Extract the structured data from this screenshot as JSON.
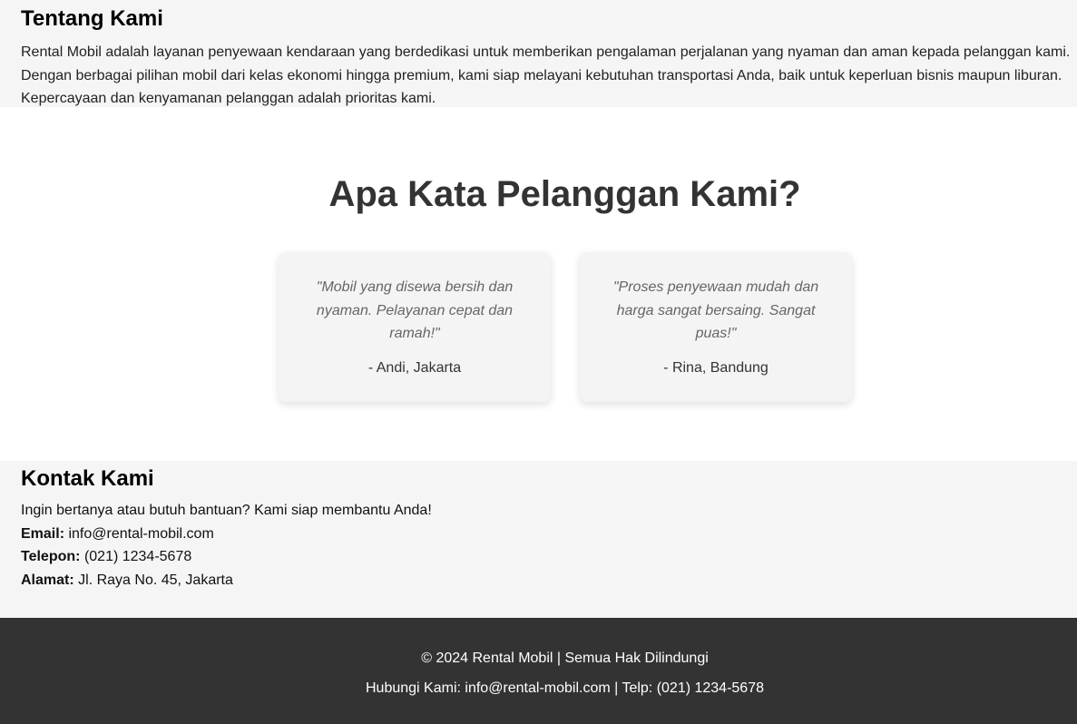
{
  "about": {
    "title": "Tentang Kami",
    "text": "Rental Mobil adalah layanan penyewaan kendaraan yang berdedikasi untuk memberikan pengalaman perjalanan yang nyaman dan aman kepada pelanggan kami. Dengan berbagai pilihan mobil dari kelas ekonomi hingga premium, kami siap melayani kebutuhan transportasi Anda, baik untuk keperluan bisnis maupun liburan. Kepercayaan dan kenyamanan pelanggan adalah prioritas kami."
  },
  "testimonials": {
    "title": "Apa Kata Pelanggan Kami?",
    "items": [
      {
        "quote": "\"Mobil yang disewa bersih dan nyaman. Pelayanan cepat dan ramah!\"",
        "author": "- Andi, Jakarta"
      },
      {
        "quote": "\"Proses penyewaan mudah dan harga sangat bersaing. Sangat puas!\"",
        "author": "- Rina, Bandung"
      }
    ]
  },
  "contact": {
    "title": "Kontak Kami",
    "intro": "Ingin bertanya atau butuh bantuan? Kami siap membantu Anda!",
    "email_label": "Email:",
    "email_value": "info@rental-mobil.com",
    "phone_label": "Telepon:",
    "phone_value": "(021) 1234-5678",
    "address_label": "Alamat:",
    "address_value": "Jl. Raya No. 45, Jakarta"
  },
  "footer": {
    "copyright": "© 2024 Rental Mobil | Semua Hak Dilindungi",
    "contact_line": "Hubungi Kami: info@rental-mobil.com | Telp: (021) 1234-5678"
  },
  "colors": {
    "section_bg": "#f5f5f5",
    "footer_bg": "#333333",
    "card_bg": "#f4f4f4",
    "heading_dark": "#333333",
    "quote_text": "#666666"
  }
}
